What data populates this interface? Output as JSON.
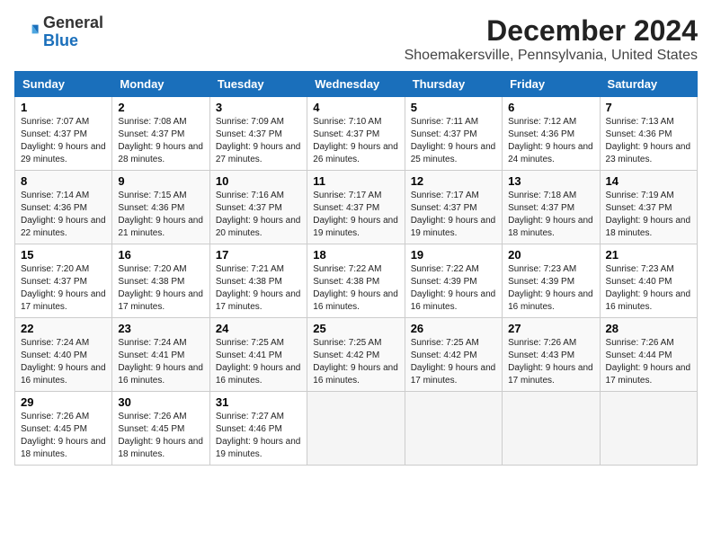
{
  "logo": {
    "general": "General",
    "blue": "Blue"
  },
  "title": "December 2024",
  "subtitle": "Shoemakersville, Pennsylvania, United States",
  "headers": [
    "Sunday",
    "Monday",
    "Tuesday",
    "Wednesday",
    "Thursday",
    "Friday",
    "Saturday"
  ],
  "weeks": [
    [
      {
        "day": "1",
        "sunrise": "Sunrise: 7:07 AM",
        "sunset": "Sunset: 4:37 PM",
        "daylight": "Daylight: 9 hours and 29 minutes."
      },
      {
        "day": "2",
        "sunrise": "Sunrise: 7:08 AM",
        "sunset": "Sunset: 4:37 PM",
        "daylight": "Daylight: 9 hours and 28 minutes."
      },
      {
        "day": "3",
        "sunrise": "Sunrise: 7:09 AM",
        "sunset": "Sunset: 4:37 PM",
        "daylight": "Daylight: 9 hours and 27 minutes."
      },
      {
        "day": "4",
        "sunrise": "Sunrise: 7:10 AM",
        "sunset": "Sunset: 4:37 PM",
        "daylight": "Daylight: 9 hours and 26 minutes."
      },
      {
        "day": "5",
        "sunrise": "Sunrise: 7:11 AM",
        "sunset": "Sunset: 4:37 PM",
        "daylight": "Daylight: 9 hours and 25 minutes."
      },
      {
        "day": "6",
        "sunrise": "Sunrise: 7:12 AM",
        "sunset": "Sunset: 4:36 PM",
        "daylight": "Daylight: 9 hours and 24 minutes."
      },
      {
        "day": "7",
        "sunrise": "Sunrise: 7:13 AM",
        "sunset": "Sunset: 4:36 PM",
        "daylight": "Daylight: 9 hours and 23 minutes."
      }
    ],
    [
      {
        "day": "8",
        "sunrise": "Sunrise: 7:14 AM",
        "sunset": "Sunset: 4:36 PM",
        "daylight": "Daylight: 9 hours and 22 minutes."
      },
      {
        "day": "9",
        "sunrise": "Sunrise: 7:15 AM",
        "sunset": "Sunset: 4:36 PM",
        "daylight": "Daylight: 9 hours and 21 minutes."
      },
      {
        "day": "10",
        "sunrise": "Sunrise: 7:16 AM",
        "sunset": "Sunset: 4:37 PM",
        "daylight": "Daylight: 9 hours and 20 minutes."
      },
      {
        "day": "11",
        "sunrise": "Sunrise: 7:17 AM",
        "sunset": "Sunset: 4:37 PM",
        "daylight": "Daylight: 9 hours and 19 minutes."
      },
      {
        "day": "12",
        "sunrise": "Sunrise: 7:17 AM",
        "sunset": "Sunset: 4:37 PM",
        "daylight": "Daylight: 9 hours and 19 minutes."
      },
      {
        "day": "13",
        "sunrise": "Sunrise: 7:18 AM",
        "sunset": "Sunset: 4:37 PM",
        "daylight": "Daylight: 9 hours and 18 minutes."
      },
      {
        "day": "14",
        "sunrise": "Sunrise: 7:19 AM",
        "sunset": "Sunset: 4:37 PM",
        "daylight": "Daylight: 9 hours and 18 minutes."
      }
    ],
    [
      {
        "day": "15",
        "sunrise": "Sunrise: 7:20 AM",
        "sunset": "Sunset: 4:37 PM",
        "daylight": "Daylight: 9 hours and 17 minutes."
      },
      {
        "day": "16",
        "sunrise": "Sunrise: 7:20 AM",
        "sunset": "Sunset: 4:38 PM",
        "daylight": "Daylight: 9 hours and 17 minutes."
      },
      {
        "day": "17",
        "sunrise": "Sunrise: 7:21 AM",
        "sunset": "Sunset: 4:38 PM",
        "daylight": "Daylight: 9 hours and 17 minutes."
      },
      {
        "day": "18",
        "sunrise": "Sunrise: 7:22 AM",
        "sunset": "Sunset: 4:38 PM",
        "daylight": "Daylight: 9 hours and 16 minutes."
      },
      {
        "day": "19",
        "sunrise": "Sunrise: 7:22 AM",
        "sunset": "Sunset: 4:39 PM",
        "daylight": "Daylight: 9 hours and 16 minutes."
      },
      {
        "day": "20",
        "sunrise": "Sunrise: 7:23 AM",
        "sunset": "Sunset: 4:39 PM",
        "daylight": "Daylight: 9 hours and 16 minutes."
      },
      {
        "day": "21",
        "sunrise": "Sunrise: 7:23 AM",
        "sunset": "Sunset: 4:40 PM",
        "daylight": "Daylight: 9 hours and 16 minutes."
      }
    ],
    [
      {
        "day": "22",
        "sunrise": "Sunrise: 7:24 AM",
        "sunset": "Sunset: 4:40 PM",
        "daylight": "Daylight: 9 hours and 16 minutes."
      },
      {
        "day": "23",
        "sunrise": "Sunrise: 7:24 AM",
        "sunset": "Sunset: 4:41 PM",
        "daylight": "Daylight: 9 hours and 16 minutes."
      },
      {
        "day": "24",
        "sunrise": "Sunrise: 7:25 AM",
        "sunset": "Sunset: 4:41 PM",
        "daylight": "Daylight: 9 hours and 16 minutes."
      },
      {
        "day": "25",
        "sunrise": "Sunrise: 7:25 AM",
        "sunset": "Sunset: 4:42 PM",
        "daylight": "Daylight: 9 hours and 16 minutes."
      },
      {
        "day": "26",
        "sunrise": "Sunrise: 7:25 AM",
        "sunset": "Sunset: 4:42 PM",
        "daylight": "Daylight: 9 hours and 17 minutes."
      },
      {
        "day": "27",
        "sunrise": "Sunrise: 7:26 AM",
        "sunset": "Sunset: 4:43 PM",
        "daylight": "Daylight: 9 hours and 17 minutes."
      },
      {
        "day": "28",
        "sunrise": "Sunrise: 7:26 AM",
        "sunset": "Sunset: 4:44 PM",
        "daylight": "Daylight: 9 hours and 17 minutes."
      }
    ],
    [
      {
        "day": "29",
        "sunrise": "Sunrise: 7:26 AM",
        "sunset": "Sunset: 4:45 PM",
        "daylight": "Daylight: 9 hours and 18 minutes."
      },
      {
        "day": "30",
        "sunrise": "Sunrise: 7:26 AM",
        "sunset": "Sunset: 4:45 PM",
        "daylight": "Daylight: 9 hours and 18 minutes."
      },
      {
        "day": "31",
        "sunrise": "Sunrise: 7:27 AM",
        "sunset": "Sunset: 4:46 PM",
        "daylight": "Daylight: 9 hours and 19 minutes."
      },
      null,
      null,
      null,
      null
    ]
  ]
}
